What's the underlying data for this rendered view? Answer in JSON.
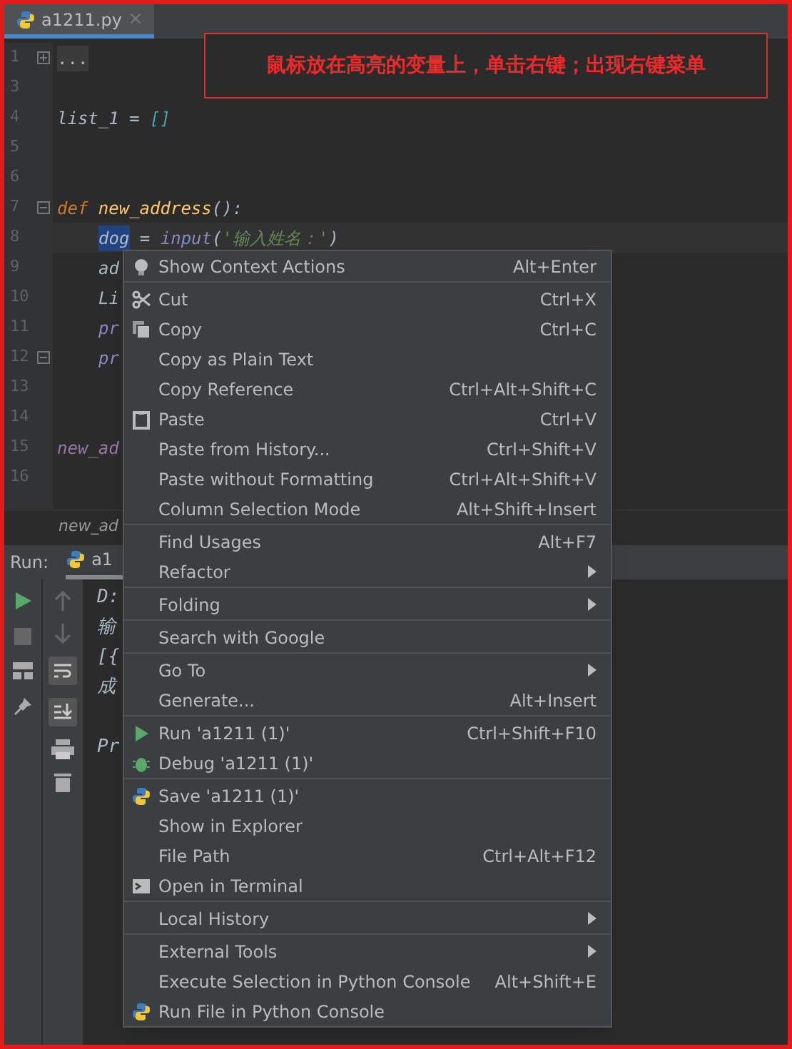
{
  "file_tab": {
    "label": "a1211.py",
    "close": "×",
    "selected": true
  },
  "annotation": "鼠标放在高亮的变量上，单击右键；出现右键菜单",
  "code_lines": [
    {
      "number": "1",
      "kind": "folded",
      "tokens": [
        {
          "text": "...",
          "kind": "plain"
        }
      ]
    },
    {
      "number": "3"
    },
    {
      "number": "4",
      "tokens": [
        {
          "text": "list_1 = ",
          "kind": "plain"
        },
        {
          "text": "[]",
          "kind": "bracket"
        }
      ]
    },
    {
      "number": "5"
    },
    {
      "number": "6"
    },
    {
      "number": "7",
      "kind": "fold_start",
      "tokens": [
        {
          "text": "def ",
          "kind": "keyword"
        },
        {
          "text": "new_address",
          "kind": "function"
        },
        {
          "text": "():",
          "kind": "plain"
        }
      ]
    },
    {
      "number": "8",
      "current": true,
      "indented": true,
      "tokens": [
        {
          "text": "dog",
          "kind": "selected"
        },
        {
          "text": " = ",
          "kind": "plain"
        },
        {
          "text": "input",
          "kind": "builtin"
        },
        {
          "text": "(",
          "kind": "plain"
        },
        {
          "text": "'输入姓名：'",
          "kind": "string"
        },
        {
          "text": ")",
          "kind": "plain"
        }
      ]
    },
    {
      "number": "9",
      "indented": true,
      "tokens": [
        {
          "text": "ad",
          "kind": "plain"
        }
      ]
    },
    {
      "number": "10",
      "indented": true,
      "tokens": [
        {
          "text": "Li",
          "kind": "plain"
        }
      ]
    },
    {
      "number": "11",
      "indented": true,
      "tokens": [
        {
          "text": "pr",
          "kind": "builtin"
        }
      ]
    },
    {
      "number": "12",
      "kind": "fold_end",
      "indented": true,
      "tokens": [
        {
          "text": "pr",
          "kind": "builtin"
        }
      ]
    },
    {
      "number": "13"
    },
    {
      "number": "14"
    },
    {
      "number": "15",
      "tokens": [
        {
          "text": "new_ad",
          "kind": "call"
        }
      ]
    },
    {
      "number": "16"
    }
  ],
  "breadcrumb": "new_ad",
  "run_panel": {
    "label": "Run:",
    "tab": "a1",
    "console_lines": [
      {
        "text": "D:"
      },
      {
        "text": "输"
      },
      {
        "text": "[{"
      },
      {
        "text": "成"
      },
      {
        "text": "Pr",
        "after_blank_line": true
      }
    ]
  },
  "context_menu": [
    [
      {
        "label": "Show Context Actions",
        "shortcut": "Alt+Enter"
      }
    ],
    [
      {
        "label": "Cut",
        "shortcut": "Ctrl+X"
      },
      {
        "label": "Copy",
        "shortcut": "Ctrl+C"
      },
      {
        "label": "Copy as Plain Text"
      },
      {
        "label": "Copy Reference",
        "shortcut": "Ctrl+Alt+Shift+C"
      },
      {
        "label": "Paste",
        "shortcut": "Ctrl+V"
      },
      {
        "label": "Paste from History...",
        "shortcut": "Ctrl+Shift+V"
      },
      {
        "label": "Paste without Formatting",
        "shortcut": "Ctrl+Alt+Shift+V"
      },
      {
        "label": "Column Selection Mode",
        "shortcut": "Alt+Shift+Insert"
      }
    ],
    [
      {
        "label": "Find Usages",
        "shortcut": "Alt+F7"
      },
      {
        "label": "Refactor",
        "submenu": true
      }
    ],
    [
      {
        "label": "Folding",
        "submenu": true
      }
    ],
    [
      {
        "label": "Search with Google"
      }
    ],
    [
      {
        "label": "Go To",
        "submenu": true
      },
      {
        "label": "Generate...",
        "shortcut": "Alt+Insert"
      }
    ],
    [
      {
        "label": "Run 'a1211 (1)'",
        "shortcut": "Ctrl+Shift+F10"
      },
      {
        "label": "Debug 'a1211 (1)'"
      }
    ],
    [
      {
        "label": "Save 'a1211 (1)'"
      },
      {
        "label": "Show in Explorer"
      },
      {
        "label": "File Path",
        "shortcut": "Ctrl+Alt+F12"
      },
      {
        "label": "Open in Terminal"
      }
    ],
    [
      {
        "label": "Local History",
        "submenu": true
      }
    ],
    [
      {
        "label": "External Tools",
        "submenu": true
      },
      {
        "label": "Execute Selection in Python Console",
        "shortcut": "Alt+Shift+E"
      },
      {
        "label": "Run File in Python Console"
      }
    ]
  ]
}
